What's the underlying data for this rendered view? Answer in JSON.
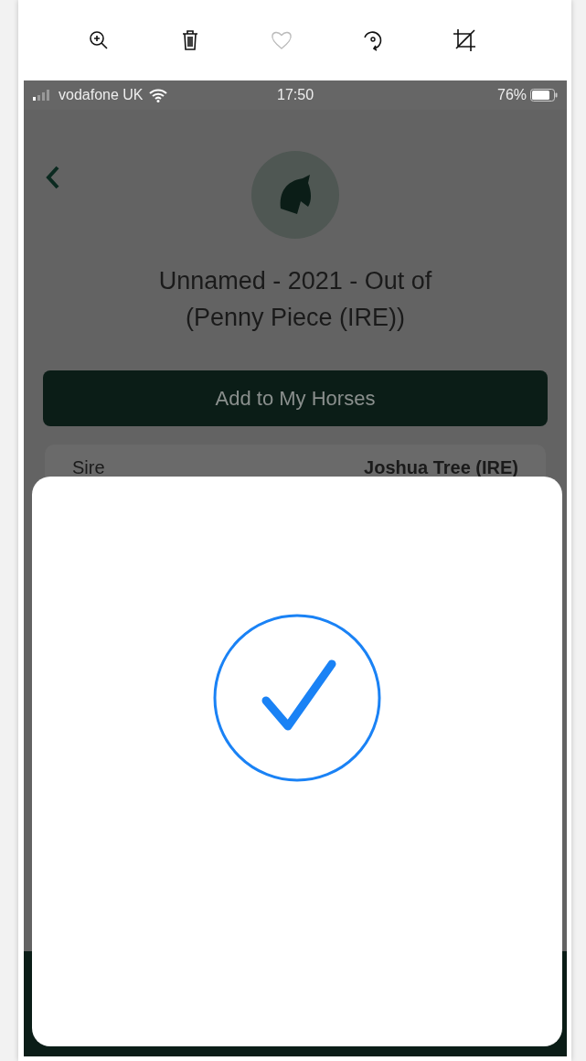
{
  "toolbar": [
    {
      "kind": "zoom"
    },
    {
      "kind": "delete"
    },
    {
      "kind": "favorite"
    },
    {
      "kind": "rotate"
    },
    {
      "kind": "crop"
    }
  ],
  "status_bar": {
    "carrier": "vodafone UK",
    "time": "17:50",
    "battery": "76%"
  },
  "header": {
    "title": "Unnamed - 2021 - Out of (Penny Piece (IRE))"
  },
  "add_button": {
    "label": "Add to My Horses"
  },
  "details": [
    {
      "label": "Sire",
      "value": "Joshua Tree (IRE)"
    }
  ],
  "modal": {
    "kind": "success"
  }
}
